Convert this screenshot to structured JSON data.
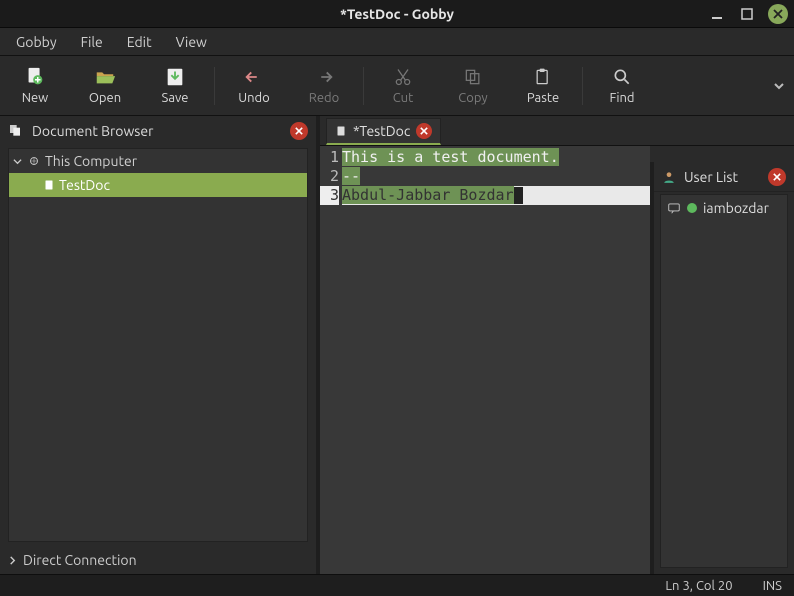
{
  "window": {
    "title": "*TestDoc - Gobby"
  },
  "menu": {
    "gobby": "Gobby",
    "file": "File",
    "edit": "Edit",
    "view": "View"
  },
  "toolbar": {
    "new": "New",
    "open": "Open",
    "save": "Save",
    "undo": "Undo",
    "redo": "Redo",
    "cut": "Cut",
    "copy": "Copy",
    "paste": "Paste",
    "find": "Find"
  },
  "docbrowser": {
    "title": "Document Browser",
    "root": "This Computer",
    "items": [
      "TestDoc"
    ],
    "footer": "Direct Connection"
  },
  "tabs": [
    {
      "label": "*TestDoc"
    }
  ],
  "editor": {
    "lines": [
      {
        "num": "1",
        "text": "This is a test document."
      },
      {
        "num": "2",
        "text": "--"
      },
      {
        "num": "3",
        "text": "Abdul-Jabbar Bozdar",
        "current": true
      }
    ]
  },
  "userlist": {
    "title": "User List",
    "users": [
      {
        "name": "iambozdar",
        "status": "online"
      }
    ]
  },
  "status": {
    "pos": "Ln 3, Col 20",
    "mode": "INS"
  }
}
